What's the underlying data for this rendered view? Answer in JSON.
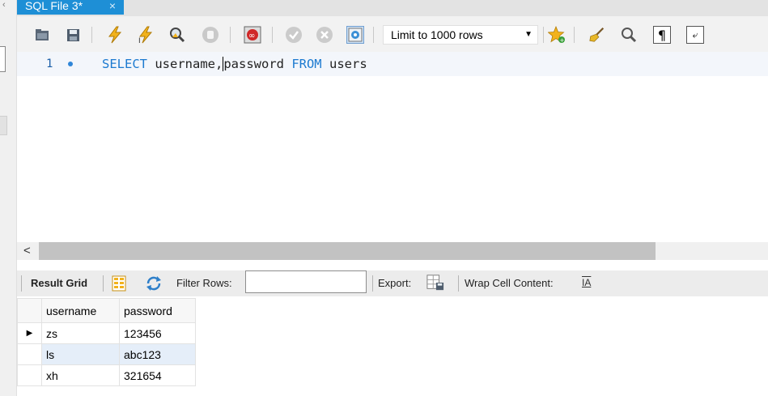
{
  "tab": {
    "title": "SQL File 3*",
    "close": "×"
  },
  "toolbar": {
    "limit_select": {
      "value": "Limit to 1000 rows"
    },
    "icons": [
      "folder-open-icon",
      "save-icon",
      "execute-icon",
      "execute-selection-icon",
      "explain-icon",
      "stop-icon",
      "toggle-error-icon",
      "commit-icon",
      "rollback-icon",
      "autocommit-icon",
      "bookmark-add-icon",
      "beautify-icon",
      "find-icon",
      "invisible-chars-icon",
      "wrap-lines-icon"
    ]
  },
  "editor": {
    "line_number": "1",
    "code": {
      "keyword1": "SELECT",
      "columns_part1": " username,",
      "columns_part2": "password",
      "keyword2": " FROM",
      "table": " users"
    }
  },
  "scroll": {
    "left_arrow": "<"
  },
  "result_toolbar": {
    "result_grid": "Result Grid",
    "filter_rows": "Filter Rows:",
    "filter_value": "",
    "export": "Export:",
    "wrap_cell": "Wrap Cell Content:",
    "wrap_glyph": "IA"
  },
  "grid": {
    "columns": [
      "username",
      "password"
    ],
    "rows": [
      {
        "indicator": "▶",
        "username": "zs",
        "password": "123456"
      },
      {
        "indicator": "",
        "username": "ls",
        "password": "abc123"
      },
      {
        "indicator": "",
        "username": "xh",
        "password": "321654"
      }
    ]
  },
  "colors": {
    "accent": "#1e8fd6",
    "keyword": "#1c7ad0",
    "line_highlight": "#f3f6fb",
    "row_selected": "#e5eef9"
  }
}
